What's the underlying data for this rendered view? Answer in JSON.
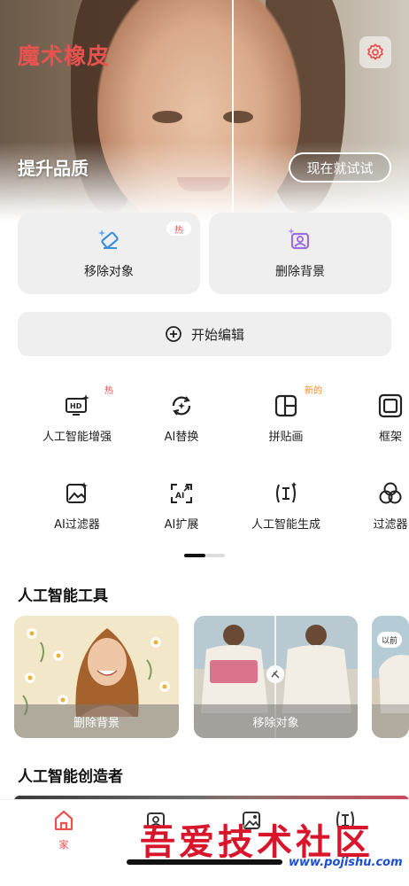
{
  "app": {
    "title": "魔术橡皮"
  },
  "hero": {
    "subtitle": "提升品质",
    "try_button": "现在就试试"
  },
  "actions": [
    {
      "label": "移除对象",
      "badge": "热",
      "icon": "eraser-sparkle-icon"
    },
    {
      "label": "删除背景",
      "icon": "remove-background-icon"
    }
  ],
  "start_edit": {
    "label": "开始编辑",
    "icon": "plus-circle-icon"
  },
  "tools": [
    {
      "label": "人工智能增强",
      "badge": "热",
      "icon": "hd-enhance-icon"
    },
    {
      "label": "AI替换",
      "icon": "swap-icon"
    },
    {
      "label": "拼贴画",
      "badge": "新的",
      "icon": "collage-icon"
    },
    {
      "label": "框架",
      "icon": "frame-icon"
    },
    {
      "label": "AI过滤器",
      "icon": "ai-filter-icon"
    },
    {
      "label": "AI扩展",
      "icon": "ai-expand-icon"
    },
    {
      "label": "人工智能生成",
      "icon": "ai-generate-icon"
    },
    {
      "label": "过滤器",
      "icon": "filter-circles-icon"
    }
  ],
  "pager": {
    "pages": 2,
    "current": 1
  },
  "ai_tools": {
    "title": "人工智能工具",
    "cards": [
      {
        "caption": "删除背景"
      },
      {
        "caption": "移除对象"
      },
      {
        "badge": "以前"
      }
    ]
  },
  "ai_creators": {
    "title": "人工智能创造者"
  },
  "nav": {
    "tabs": [
      {
        "label": "家",
        "icon": "home-icon",
        "active": true
      },
      {
        "label": "",
        "icon": "image-sparkle-icon"
      },
      {
        "label": "",
        "icon": "gallery-icon"
      },
      {
        "label": "",
        "icon": "text-cursor-icon"
      }
    ]
  },
  "watermark": {
    "text": "吾爱技术社区",
    "url": "www.pojishu.com"
  },
  "colors": {
    "accent": "#e8524f",
    "badge_hot": "#e8524f",
    "badge_new": "#f08a1a"
  }
}
